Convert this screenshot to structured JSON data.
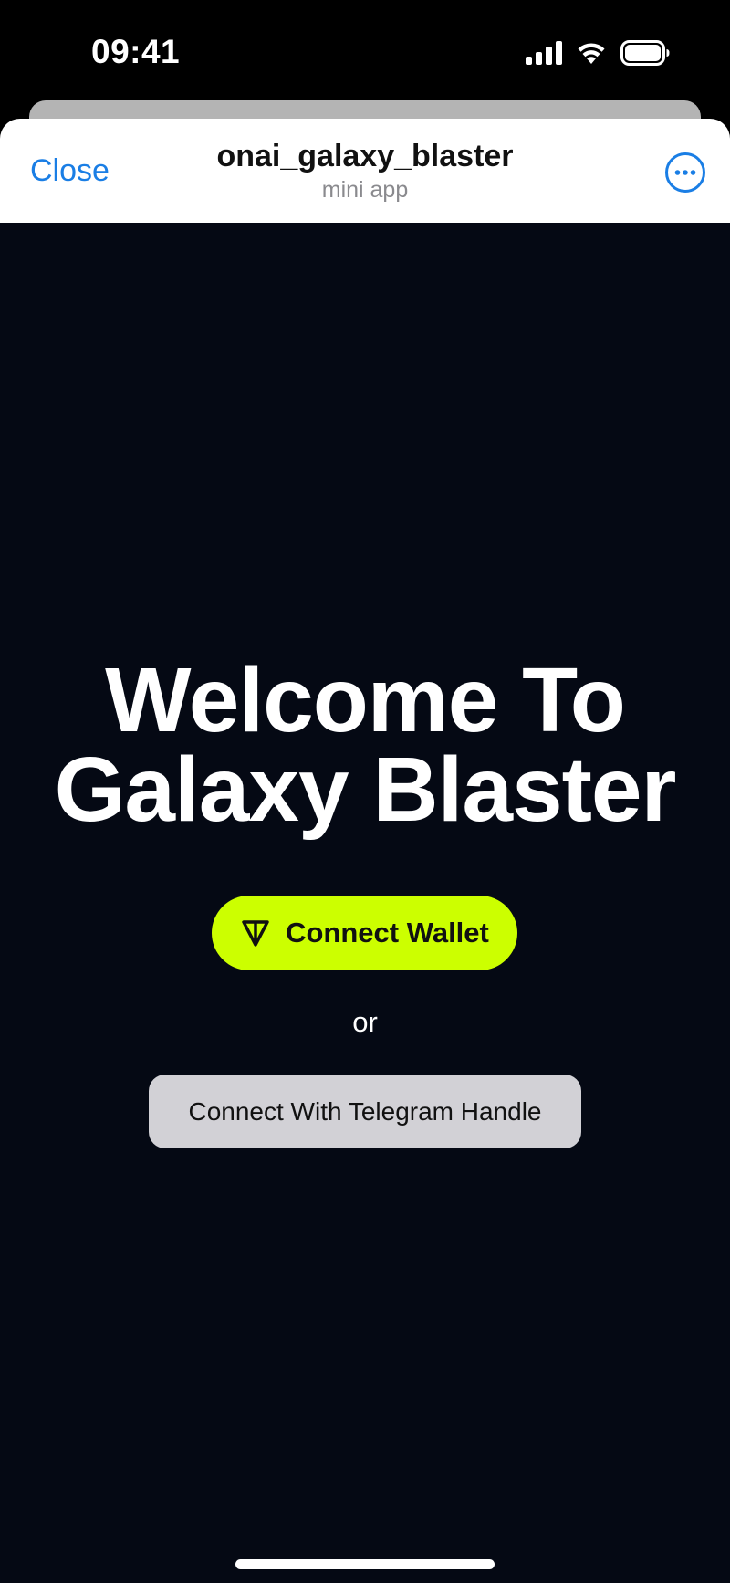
{
  "status_bar": {
    "time": "09:41",
    "icons": [
      "cellular-signal-icon",
      "wifi-icon",
      "battery-icon"
    ]
  },
  "header": {
    "close_label": "Close",
    "title": "onai_galaxy_blaster",
    "subtitle": "mini app",
    "more_icon": "more-options-icon"
  },
  "main": {
    "welcome_line1": "Welcome To",
    "welcome_line2": "Galaxy Blaster",
    "connect_wallet_label": "Connect Wallet",
    "connect_wallet_icon": "ton-logo-icon",
    "or_label": "or",
    "connect_telegram_label": "Connect With Telegram Handle"
  },
  "colors": {
    "accent": "#1a7ee5",
    "app_background": "#050914",
    "wallet_button": "#ccff00",
    "telegram_button": "#d2d1d6"
  }
}
